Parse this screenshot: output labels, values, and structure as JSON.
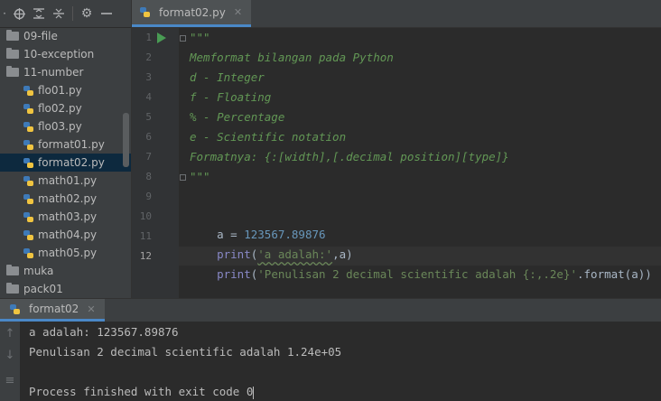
{
  "project": {
    "tree": [
      {
        "label": "09-file",
        "type": "folder"
      },
      {
        "label": "10-exception",
        "type": "folder"
      },
      {
        "label": "11-number",
        "type": "folder"
      },
      {
        "label": "flo01.py",
        "type": "file"
      },
      {
        "label": "flo02.py",
        "type": "file"
      },
      {
        "label": "flo03.py",
        "type": "file"
      },
      {
        "label": "format01.py",
        "type": "file"
      },
      {
        "label": "format02.py",
        "type": "file",
        "selected": true
      },
      {
        "label": "math01.py",
        "type": "file"
      },
      {
        "label": "math02.py",
        "type": "file"
      },
      {
        "label": "math03.py",
        "type": "file"
      },
      {
        "label": "math04.py",
        "type": "file"
      },
      {
        "label": "math05.py",
        "type": "file"
      },
      {
        "label": "muka",
        "type": "folder"
      },
      {
        "label": "pack01",
        "type": "folder"
      }
    ]
  },
  "editor": {
    "tab_label": "format02.py",
    "line_numbers": [
      "1",
      "2",
      "3",
      "4",
      "5",
      "6",
      "7",
      "8",
      "9",
      "10",
      "11",
      "12"
    ],
    "current_line": "12",
    "lines": {
      "l1": "\"\"\"",
      "l2": "Memformat bilangan pada Python",
      "l3": "d - Integer",
      "l4": "f - Floating",
      "l5": "% - Percentage",
      "l6": "e - Scientific notation",
      "l7": "Formatnya: {:[width],[.decimal position][type]}",
      "l8": "\"\"\"",
      "l10_name": "a = ",
      "l10_value": "123567.89876",
      "l11_fn": "print",
      "l11_open": "(",
      "l11_str": "'a adalah:'",
      "l11_rest": ",a)",
      "l12_fn": "print",
      "l12_open": "(",
      "l12_str": "'Penulisan 2 decimal scientific adalah {:,.2e}'",
      "l12_rest": ".format(a))"
    }
  },
  "run": {
    "tab_label": "format02",
    "output": [
      "a adalah: 123567.89876",
      "Penulisan 2 decimal scientific adalah 1.24e+05",
      "",
      "Process finished with exit code 0"
    ]
  },
  "colors": {
    "background": "#2b2b2b",
    "panel": "#3c3f41",
    "selection": "#0d293e",
    "docstring": "#629755",
    "string": "#6a8759",
    "number": "#6897bb",
    "builtin": "#8888c6",
    "run_green": "#499c54"
  }
}
